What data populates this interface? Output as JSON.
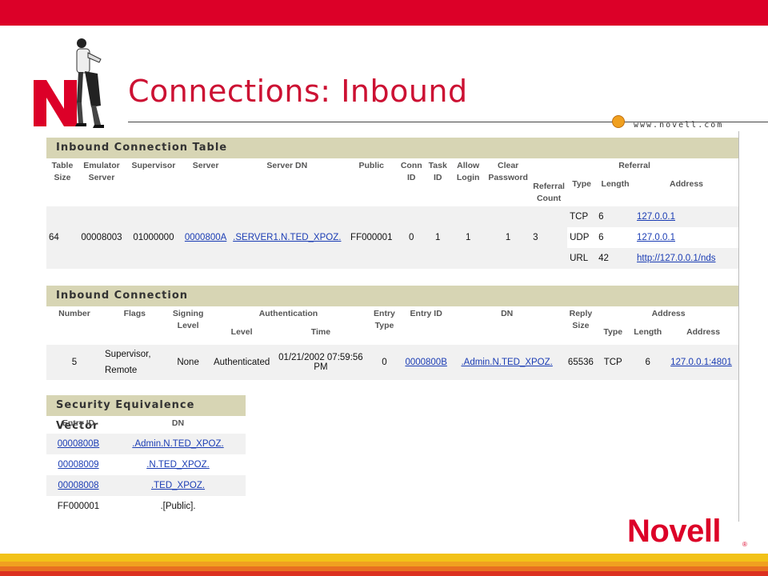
{
  "slide": {
    "title": "Connections: Inbound",
    "url_text": "www.novell.com",
    "brand": "Novell",
    "registered_mark": "®"
  },
  "inbound_connection_table": {
    "heading": "Inbound Connection Table",
    "headers": {
      "table_size": "Table Size",
      "emulator_server": "Emulator Server",
      "supervisor": "Supervisor",
      "server": "Server",
      "server_dn": "Server DN",
      "public": "Public",
      "conn_id": "Conn ID",
      "task_id": "Task ID",
      "allow_login": "Allow Login",
      "clear_password": "Clear Password",
      "referral": "Referral",
      "referral_count": "Referral Count",
      "type": "Type",
      "length": "Length",
      "address": "Address"
    },
    "row": {
      "table_size": "64",
      "emulator_server": "00008003",
      "supervisor": "01000000",
      "server": "0000800A",
      "server_dn": ".SERVER1.N.TED_XPOZ.",
      "public": "FF000001",
      "conn_id": "0",
      "task_id": "1",
      "allow_login": "1",
      "clear_password": "1",
      "referral_count": "3"
    },
    "referrals": [
      {
        "type": "TCP",
        "length": "6",
        "address": "127.0.0.1"
      },
      {
        "type": "UDP",
        "length": "6",
        "address": "127.0.0.1"
      },
      {
        "type": "URL",
        "length": "42",
        "address": "http://127.0.0.1/nds"
      }
    ]
  },
  "inbound_connection": {
    "heading": "Inbound Connection",
    "headers": {
      "number": "Number",
      "flags": "Flags",
      "signing_level": "Signing Level",
      "authentication": "Authentication",
      "level": "Level",
      "time": "Time",
      "entry_type": "Entry Type",
      "entry_id": "Entry ID",
      "dn": "DN",
      "reply_size": "Reply Size",
      "address": "Address",
      "type": "Type",
      "length": "Length",
      "address_sub": "Address"
    },
    "row": {
      "number": "5",
      "flags_line1": "Supervisor,",
      "flags_line2": "Remote",
      "signing_level": "None",
      "auth_level": "Authenticated",
      "auth_time": "01/21/2002 07:59:56 PM",
      "entry_type": "0",
      "entry_id": "0000800B",
      "dn": ".Admin.N.TED_XPOZ.",
      "reply_size": "65536",
      "addr_type": "TCP",
      "addr_length": "6",
      "address": "127.0.0.1:4801"
    }
  },
  "security_equivalence_vector": {
    "heading": "Security Equivalence Vector",
    "headers": {
      "entry_id": "Entry ID",
      "dn": "DN"
    },
    "rows": [
      {
        "entry_id": "0000800B",
        "dn": ".Admin.N.TED_XPOZ."
      },
      {
        "entry_id": "00008009",
        "dn": ".N.TED_XPOZ."
      },
      {
        "entry_id": "00008008",
        "dn": ".TED_XPOZ."
      },
      {
        "entry_id": "FF000001",
        "dn": ".[Public]."
      }
    ]
  },
  "colors": {
    "brand_red": "#dc0028",
    "section_header": "#d7d5b4",
    "link_blue": "#1a3cb4",
    "accent_orange": "#f0a020"
  }
}
